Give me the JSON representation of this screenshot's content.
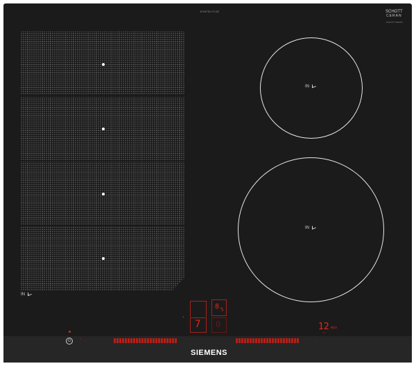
{
  "brand": "SIEMENS",
  "glass_maker": {
    "line1": "SCHOTT",
    "line2": "CERAN"
  },
  "model_code": "EX675LYC1E",
  "plate_label": "SCHOTT CERAN",
  "flex_zone": {
    "marking": "IN",
    "segments": 4
  },
  "round_zones": [
    {
      "marking": "IN"
    },
    {
      "marking": "IN"
    }
  ],
  "controls": {
    "power_icon": "power-icon",
    "left_display_level": "7",
    "left_display_upper": "8.",
    "left_display_upper_sub": "5",
    "left_display_right": "0",
    "timer_value": "12",
    "timer_unit": "min"
  },
  "colors": {
    "glass": "#1b1b1b",
    "accent_red": "#e0281e",
    "zone_outline": "#e8e8e8"
  }
}
